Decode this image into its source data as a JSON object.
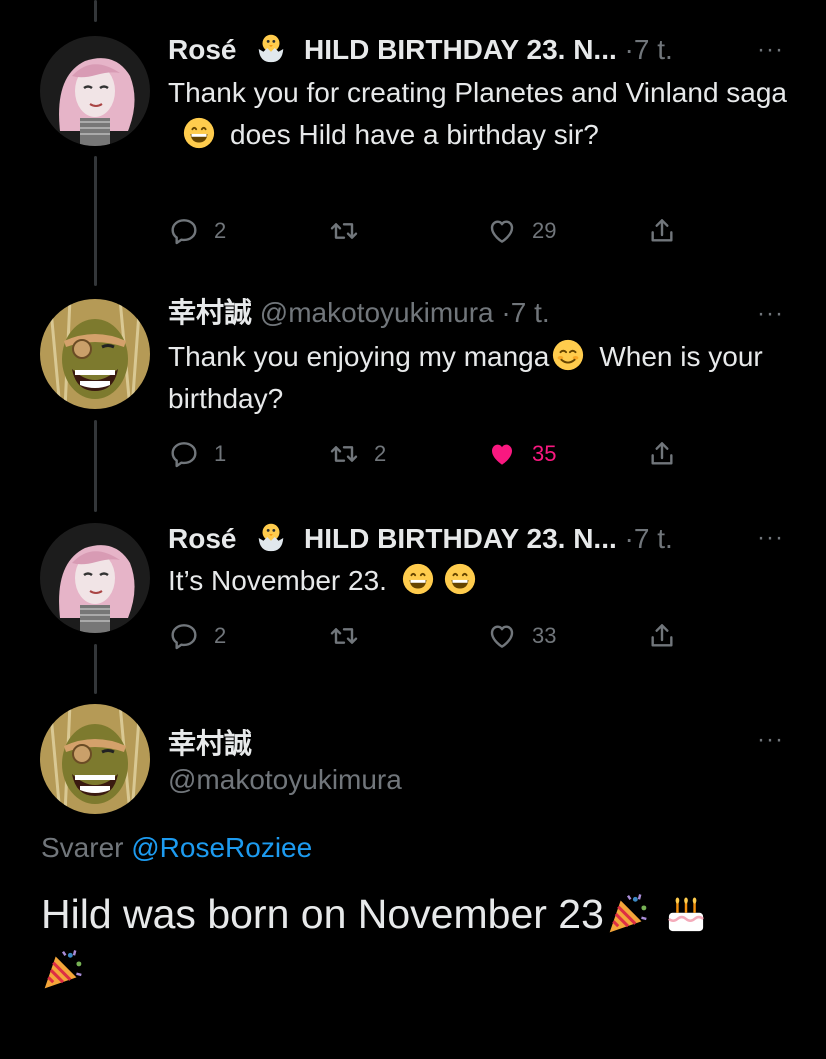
{
  "tweets": [
    {
      "name": "Rosé",
      "badge_text": "HILD BIRTHDAY 23. N...",
      "separator": "·",
      "time": "7 t.",
      "text_parts": [
        "Thank you for creating Planetes and Vinland saga",
        "does Hild have a birthday sir?"
      ],
      "reply_count": "2",
      "retweet_count": "",
      "like_count": "29",
      "liked": false
    },
    {
      "name": "幸村誠",
      "handle": "@makotoyukimura",
      "separator": "·",
      "time": "7 t.",
      "text_parts": [
        "Thank you enjoying my manga",
        "When is your birthday?"
      ],
      "reply_count": "1",
      "retweet_count": "2",
      "like_count": "35",
      "liked": true
    },
    {
      "name": "Rosé",
      "badge_text": "HILD BIRTHDAY 23. N...",
      "separator": "·",
      "time": "7 t.",
      "text_parts": [
        "It’s November 23."
      ],
      "reply_count": "2",
      "retweet_count": "",
      "like_count": "33",
      "liked": false
    }
  ],
  "main_tweet": {
    "name": "幸村誠",
    "handle": "@makotoyukimura",
    "replying_label": "Svarer",
    "replying_to": "@RoseRoziee",
    "text": "Hild was born on November 23"
  },
  "more_label": "···",
  "colors": {
    "background": "#000000",
    "text": "#e7e9ea",
    "muted": "#71767b",
    "link": "#1d9bf0",
    "like": "#f91880",
    "thread_line": "#333639"
  },
  "icons": [
    "reply-icon",
    "retweet-icon",
    "like-icon",
    "share-icon",
    "more-icon",
    "grin-emoji",
    "smile-emoji",
    "party-popper-emoji",
    "birthday-cake-emoji",
    "hatching-chick-emoji"
  ]
}
